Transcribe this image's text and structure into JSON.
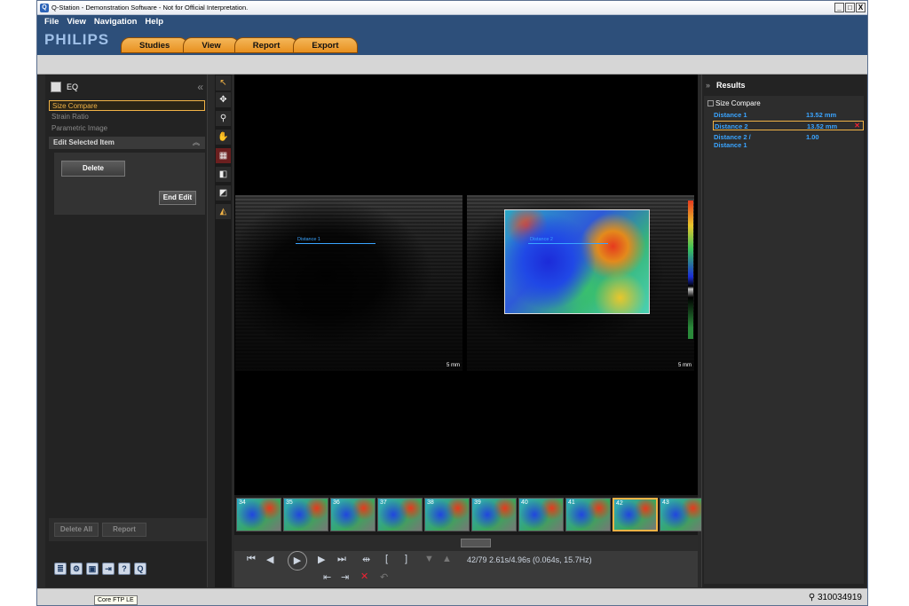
{
  "window": {
    "title": "Q-Station - Demonstration Software - Not for Official Interpretation.",
    "controls": [
      "_",
      "□",
      "X"
    ]
  },
  "menu": [
    "File",
    "View",
    "Navigation",
    "Help"
  ],
  "brand": "PHILIPS",
  "tabs": [
    "Studies",
    "View",
    "Report",
    "Export"
  ],
  "left_panel": {
    "header": "EQ",
    "items": [
      "Size Compare",
      "Strain Ratio",
      "Parametric Image"
    ],
    "selected_index": 0,
    "edit_section": "Edit Selected Item",
    "delete_label": "Delete",
    "end_edit_label": "End Edit",
    "delete_all_label": "Delete All",
    "report_label": "Report"
  },
  "viewer": {
    "left_image": {
      "measure_label": "Distance 1",
      "scale": "5 mm"
    },
    "right_image": {
      "measure_label": "Distance 2",
      "scale": "5 mm"
    }
  },
  "thumbnails": [
    "34",
    "35",
    "36",
    "37",
    "38",
    "39",
    "40",
    "41",
    "42",
    "43"
  ],
  "selected_thumbnail": "42",
  "playback": {
    "status": "42/79  2.61s/4.96s (0.064s, 15.7Hz)"
  },
  "results": {
    "header": "Results",
    "group": "Size Compare",
    "rows": [
      {
        "name": "Distance 1",
        "value": "13.52 mm"
      },
      {
        "name": "Distance 2",
        "value": "13.52 mm",
        "selected": true
      },
      {
        "name": "Distance 2 /",
        "name2": "Distance 1",
        "value": "1.00"
      }
    ]
  },
  "status": {
    "id": "310034919",
    "tooltip": "Core FTP LE"
  }
}
